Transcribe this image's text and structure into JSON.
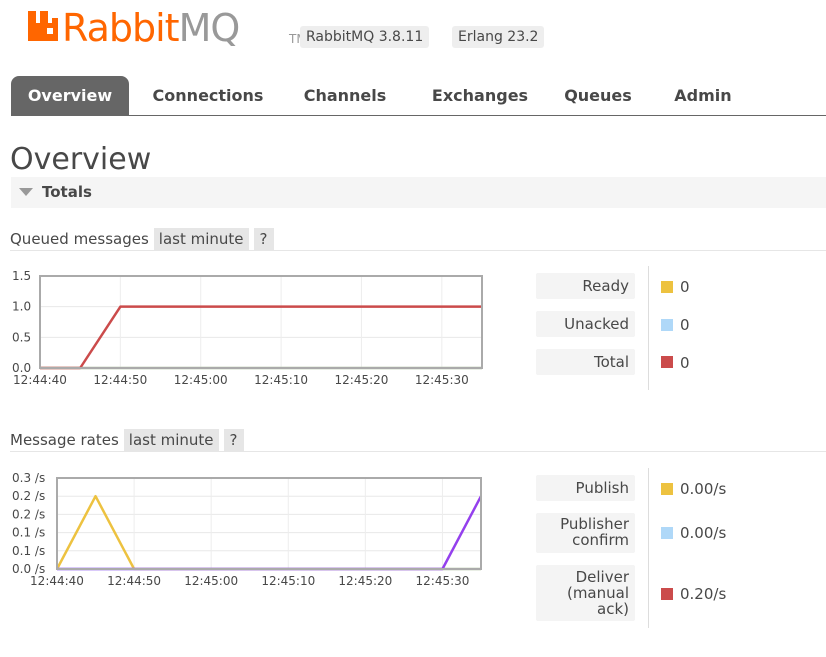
{
  "header": {
    "logo_rabbit": "Rabbit",
    "logo_mq": "MQ",
    "logo_tm": "TM",
    "rabbitmq_version": "RabbitMQ 3.8.11",
    "erlang_version": "Erlang 23.2",
    "brand_color": "#ff6600"
  },
  "tabs": [
    {
      "label": "Overview",
      "active": true
    },
    {
      "label": "Connections",
      "active": false
    },
    {
      "label": "Channels",
      "active": false
    },
    {
      "label": "Exchanges",
      "active": false
    },
    {
      "label": "Queues",
      "active": false
    },
    {
      "label": "Admin",
      "active": false
    }
  ],
  "page": {
    "title": "Overview",
    "totals_label": "Totals"
  },
  "queued": {
    "title": "Queued messages",
    "range": "last minute",
    "help": "?",
    "legend": [
      {
        "label": "Ready",
        "color": "#edc240",
        "value": "0"
      },
      {
        "label": "Unacked",
        "color": "#afd8f8",
        "value": "0"
      },
      {
        "label": "Total",
        "color": "#cb4b4b",
        "value": "0"
      }
    ]
  },
  "rates": {
    "title": "Message rates",
    "range": "last minute",
    "help": "?",
    "legend": [
      {
        "label": "Publish",
        "color": "#edc240",
        "value": "0.00/s"
      },
      {
        "label": "Publisher confirm",
        "color": "#afd8f8",
        "value": "0.00/s"
      },
      {
        "label": "Deliver (manual ack)",
        "color": "#cb4b4b",
        "value": "0.20/s"
      }
    ]
  },
  "chart_data": [
    {
      "type": "line",
      "title": "Queued messages",
      "x": [
        "12:44:40",
        "12:44:45",
        "12:44:50",
        "12:44:55",
        "12:45:00",
        "12:45:05",
        "12:45:10",
        "12:45:15",
        "12:45:20",
        "12:45:25",
        "12:45:30",
        "12:45:35"
      ],
      "x_ticks": [
        "12:44:40",
        "12:44:50",
        "12:45:00",
        "12:45:10",
        "12:45:20",
        "12:45:30"
      ],
      "y_ticks": [
        "1.5",
        "1.0",
        "0.5",
        "0.0"
      ],
      "ylim": [
        0,
        1.5
      ],
      "grid": true,
      "series": [
        {
          "name": "Ready",
          "color": "#edc240",
          "values": [
            0,
            0,
            0,
            0,
            0,
            0,
            0,
            0,
            0,
            0,
            0,
            0
          ]
        },
        {
          "name": "Unacked",
          "color": "#afd8f8",
          "values": [
            0,
            0,
            0,
            0,
            0,
            0,
            0,
            0,
            0,
            0,
            0,
            0
          ]
        },
        {
          "name": "Total",
          "color": "#cb4b4b",
          "values": [
            0,
            0,
            1,
            1,
            1,
            1,
            1,
            1,
            1,
            1,
            1,
            1
          ]
        }
      ]
    },
    {
      "type": "line",
      "title": "Message rates",
      "x": [
        "12:44:40",
        "12:44:45",
        "12:44:50",
        "12:44:55",
        "12:45:00",
        "12:45:05",
        "12:45:10",
        "12:45:15",
        "12:45:20",
        "12:45:25",
        "12:45:30",
        "12:45:35"
      ],
      "x_ticks": [
        "12:44:40",
        "12:44:50",
        "12:45:00",
        "12:45:10",
        "12:45:20",
        "12:45:30"
      ],
      "y_ticks": [
        "0.3 /s",
        "0.2 /s",
        "0.2 /s",
        "0.1 /s",
        "0.1 /s",
        "0.0 /s"
      ],
      "ylim": [
        0,
        0.25
      ],
      "grid": true,
      "series": [
        {
          "name": "Publish",
          "color": "#edc240",
          "values": [
            0,
            0.2,
            0,
            0,
            0,
            0,
            0,
            0,
            0,
            0,
            0,
            0
          ]
        },
        {
          "name": "Publisher confirm",
          "color": "#afd8f8",
          "values": [
            0,
            0,
            0,
            0,
            0,
            0,
            0,
            0,
            0,
            0,
            0,
            0
          ]
        },
        {
          "name": "Deliver (manual ack)",
          "color": "#9440ed",
          "values": [
            0,
            0,
            0,
            0,
            0,
            0,
            0,
            0,
            0,
            0,
            0,
            0.2
          ]
        }
      ]
    }
  ]
}
